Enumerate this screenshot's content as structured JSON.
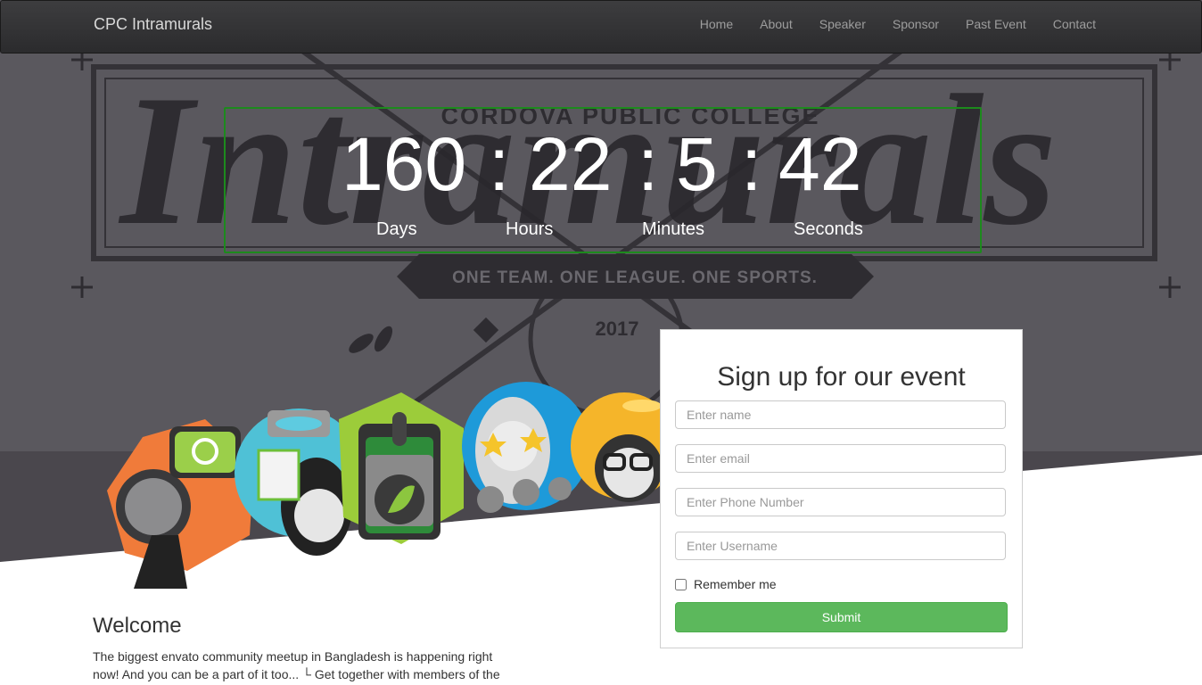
{
  "navbar": {
    "brand": "CPC Intramurals",
    "links": [
      "Home",
      "About",
      "Speaker",
      "Sponsor",
      "Past Event",
      "Contact"
    ]
  },
  "hero": {
    "banner_school": "CORDOVA PUBLIC COLLEGE",
    "banner_script": "Intramurals",
    "banner_tagline": "ONE TEAM. ONE LEAGUE. ONE SPORTS.",
    "banner_year": "2017"
  },
  "countdown": {
    "days": "160",
    "hours": "22",
    "minutes": "5",
    "seconds": "42",
    "separator": ":",
    "labels": {
      "days": "Days",
      "hours": "Hours",
      "minutes": "Minutes",
      "seconds": "Seconds"
    }
  },
  "signup": {
    "title": "Sign up for our event",
    "name_placeholder": "Enter name",
    "email_placeholder": "Enter email",
    "phone_placeholder": "Enter Phone Number",
    "username_placeholder": "Enter Username",
    "remember_label": "Remember me",
    "submit_label": "Submit"
  },
  "welcome": {
    "title": "Welcome",
    "text": "The biggest envato community meetup in Bangladesh is happening right now! And you can be a part of it too... └ Get together with members of the"
  },
  "colors": {
    "accent_green": "#5cb85c",
    "countdown_border": "#1d8a1d",
    "navbar_bg": "#2b2b2d"
  }
}
